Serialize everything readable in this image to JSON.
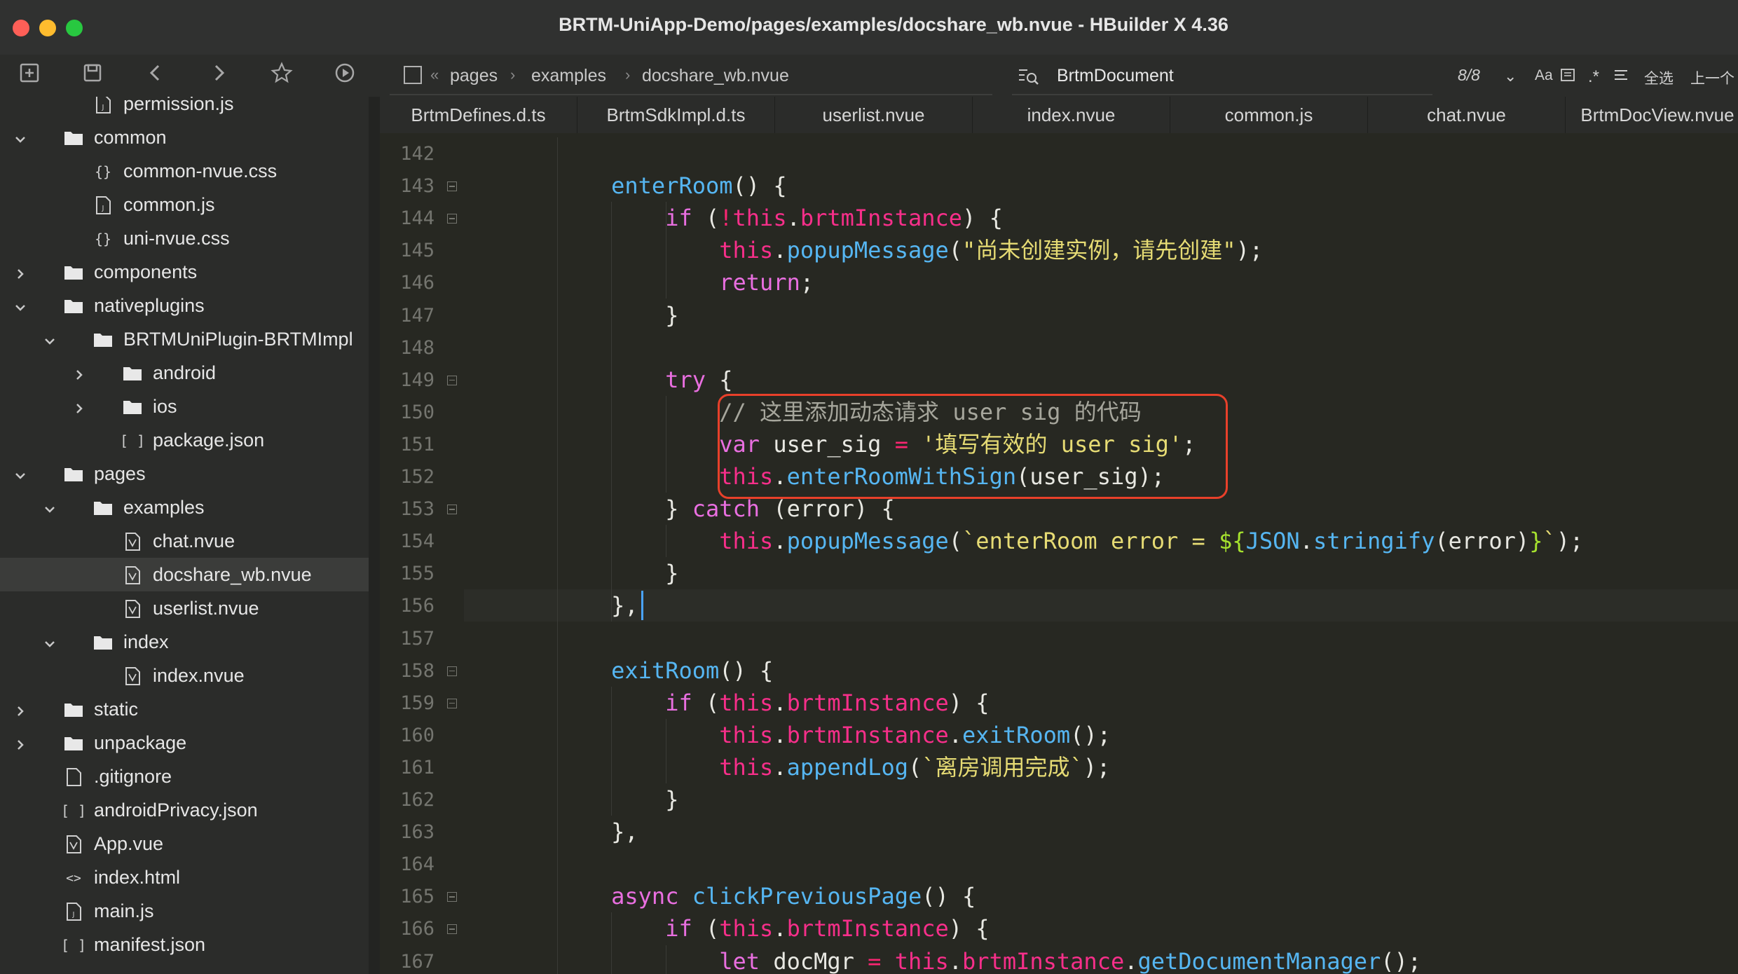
{
  "window": {
    "title": "BRTM-UniApp-Demo/pages/examples/docshare_wb.nvue - HBuilder X 4.36"
  },
  "toolbar": {
    "breadcrumb": [
      "pages",
      "examples",
      "docshare_wb.nvue"
    ],
    "breadcrumb_prefix": "«",
    "search": {
      "value": "BrtmDocument"
    },
    "match_count": "8/8",
    "options": [
      "Aa",
      "全选",
      "上一个"
    ]
  },
  "sidebar": {
    "items": [
      {
        "label": "permission.js",
        "depth": 2,
        "icon": "js-file-icon",
        "chevron": ""
      },
      {
        "label": "common",
        "depth": 1,
        "icon": "folder-icon",
        "chevron": "open"
      },
      {
        "label": "common-nvue.css",
        "depth": 2,
        "icon": "css-file-icon",
        "chevron": ""
      },
      {
        "label": "common.js",
        "depth": 2,
        "icon": "js-file-icon",
        "chevron": ""
      },
      {
        "label": "uni-nvue.css",
        "depth": 2,
        "icon": "css-file-icon",
        "chevron": ""
      },
      {
        "label": "components",
        "depth": 1,
        "icon": "folder-icon",
        "chevron": "closed"
      },
      {
        "label": "nativeplugins",
        "depth": 1,
        "icon": "folder-icon",
        "chevron": "open"
      },
      {
        "label": "BRTMUniPlugin-BRTMImpl",
        "depth": 2,
        "icon": "folder-icon",
        "chevron": "open"
      },
      {
        "label": "android",
        "depth": 3,
        "icon": "folder-icon",
        "chevron": "closed"
      },
      {
        "label": "ios",
        "depth": 3,
        "icon": "folder-icon",
        "chevron": "closed"
      },
      {
        "label": "package.json",
        "depth": 3,
        "icon": "json-file-icon",
        "chevron": ""
      },
      {
        "label": "pages",
        "depth": 1,
        "icon": "folder-icon",
        "chevron": "open"
      },
      {
        "label": "examples",
        "depth": 2,
        "icon": "folder-icon",
        "chevron": "open"
      },
      {
        "label": "chat.nvue",
        "depth": 3,
        "icon": "vue-file-icon",
        "chevron": ""
      },
      {
        "label": "docshare_wb.nvue",
        "depth": 3,
        "icon": "vue-file-icon",
        "chevron": "",
        "selected": true
      },
      {
        "label": "userlist.nvue",
        "depth": 3,
        "icon": "vue-file-icon",
        "chevron": ""
      },
      {
        "label": "index",
        "depth": 2,
        "icon": "folder-icon",
        "chevron": "open"
      },
      {
        "label": "index.nvue",
        "depth": 3,
        "icon": "vue-file-icon",
        "chevron": ""
      },
      {
        "label": "static",
        "depth": 1,
        "icon": "folder-icon",
        "chevron": "closed"
      },
      {
        "label": "unpackage",
        "depth": 1,
        "icon": "folder-icon",
        "chevron": "closed"
      },
      {
        "label": ".gitignore",
        "depth": 1,
        "icon": "file-icon",
        "chevron": ""
      },
      {
        "label": "androidPrivacy.json",
        "depth": 1,
        "icon": "json-file-icon",
        "chevron": ""
      },
      {
        "label": "App.vue",
        "depth": 1,
        "icon": "vue-file-icon",
        "chevron": ""
      },
      {
        "label": "index.html",
        "depth": 1,
        "icon": "html-file-icon",
        "chevron": ""
      },
      {
        "label": "main.js",
        "depth": 1,
        "icon": "js-file-icon",
        "chevron": ""
      },
      {
        "label": "manifest.json",
        "depth": 1,
        "icon": "json-file-icon",
        "chevron": ""
      }
    ]
  },
  "tabs": [
    "BrtmDefines.d.ts",
    "BrtmSdkImpl.d.ts",
    "userlist.nvue",
    "index.nvue",
    "common.js",
    "chat.nvue",
    "BrtmDocView.nvue"
  ],
  "editor": {
    "lines": [
      {
        "n": "142",
        "fold": false,
        "tokens": []
      },
      {
        "n": "143",
        "fold": true,
        "tokens": [
          [
            "pl",
            "        "
          ],
          [
            "fn",
            "enterRoom"
          ],
          [
            "pl",
            "() {"
          ]
        ]
      },
      {
        "n": "144",
        "fold": true,
        "tokens": [
          [
            "pl",
            "            "
          ],
          [
            "ky",
            "if"
          ],
          [
            "pl",
            " ("
          ],
          [
            "k",
            "!"
          ],
          [
            "th",
            "this"
          ],
          [
            "pl",
            "."
          ],
          [
            "th",
            "brtmInstance"
          ],
          [
            "pl",
            ") {"
          ]
        ]
      },
      {
        "n": "145",
        "fold": false,
        "tokens": [
          [
            "pl",
            "                "
          ],
          [
            "th",
            "this"
          ],
          [
            "pl",
            "."
          ],
          [
            "fn",
            "popupMessage"
          ],
          [
            "pl",
            "("
          ],
          [
            "st",
            "\"尚未创建实例，请先创建\""
          ],
          [
            "pl",
            ");"
          ]
        ]
      },
      {
        "n": "146",
        "fold": false,
        "tokens": [
          [
            "pl",
            "                "
          ],
          [
            "ky",
            "return"
          ],
          [
            "pl",
            ";"
          ]
        ]
      },
      {
        "n": "147",
        "fold": false,
        "tokens": [
          [
            "pl",
            "            }"
          ]
        ]
      },
      {
        "n": "148",
        "fold": false,
        "tokens": []
      },
      {
        "n": "149",
        "fold": true,
        "tokens": [
          [
            "pl",
            "            "
          ],
          [
            "ky",
            "try"
          ],
          [
            "pl",
            " {"
          ]
        ]
      },
      {
        "n": "150",
        "fold": false,
        "tokens": [
          [
            "pl",
            "                "
          ],
          [
            "cm",
            "// 这里添加动态请求 user sig 的代码"
          ]
        ]
      },
      {
        "n": "151",
        "fold": false,
        "tokens": [
          [
            "pl",
            "                "
          ],
          [
            "ky",
            "var"
          ],
          [
            "pl",
            " user_sig "
          ],
          [
            "k",
            "="
          ],
          [
            "pl",
            " "
          ],
          [
            "st",
            "'填写有效的 user sig'"
          ],
          [
            "pl",
            ";"
          ]
        ]
      },
      {
        "n": "152",
        "fold": false,
        "tokens": [
          [
            "pl",
            "                "
          ],
          [
            "th",
            "this"
          ],
          [
            "pl",
            "."
          ],
          [
            "fn",
            "enterRoomWithSign"
          ],
          [
            "pl",
            "(user_sig);"
          ]
        ]
      },
      {
        "n": "153",
        "fold": true,
        "tokens": [
          [
            "pl",
            "            } "
          ],
          [
            "ky",
            "catch"
          ],
          [
            "pl",
            " (error) {"
          ]
        ]
      },
      {
        "n": "154",
        "fold": false,
        "tokens": [
          [
            "pl",
            "                "
          ],
          [
            "th",
            "this"
          ],
          [
            "pl",
            "."
          ],
          [
            "fn",
            "popupMessage"
          ],
          [
            "pl",
            "("
          ],
          [
            "st",
            "`enterRoom error = "
          ],
          [
            "grn",
            "${"
          ],
          [
            "fn",
            "JSON"
          ],
          [
            "pl",
            "."
          ],
          [
            "fn",
            "stringify"
          ],
          [
            "pl",
            "(error)"
          ],
          [
            "grn",
            "}"
          ],
          [
            "st",
            "`"
          ],
          [
            "pl",
            ");"
          ]
        ]
      },
      {
        "n": "155",
        "fold": false,
        "tokens": [
          [
            "pl",
            "            }"
          ]
        ]
      },
      {
        "n": "156",
        "fold": false,
        "tokens": [
          [
            "pl",
            "        },"
          ]
        ],
        "current": true
      },
      {
        "n": "157",
        "fold": false,
        "tokens": []
      },
      {
        "n": "158",
        "fold": true,
        "tokens": [
          [
            "pl",
            "        "
          ],
          [
            "fn",
            "exitRoom"
          ],
          [
            "pl",
            "() {"
          ]
        ]
      },
      {
        "n": "159",
        "fold": true,
        "tokens": [
          [
            "pl",
            "            "
          ],
          [
            "ky",
            "if"
          ],
          [
            "pl",
            " ("
          ],
          [
            "th",
            "this"
          ],
          [
            "pl",
            "."
          ],
          [
            "th",
            "brtmInstance"
          ],
          [
            "pl",
            ") {"
          ]
        ]
      },
      {
        "n": "160",
        "fold": false,
        "tokens": [
          [
            "pl",
            "                "
          ],
          [
            "th",
            "this"
          ],
          [
            "pl",
            "."
          ],
          [
            "th",
            "brtmInstance"
          ],
          [
            "pl",
            "."
          ],
          [
            "fn",
            "exitRoom"
          ],
          [
            "pl",
            "();"
          ]
        ]
      },
      {
        "n": "161",
        "fold": false,
        "tokens": [
          [
            "pl",
            "                "
          ],
          [
            "th",
            "this"
          ],
          [
            "pl",
            "."
          ],
          [
            "fn",
            "appendLog"
          ],
          [
            "pl",
            "("
          ],
          [
            "st",
            "`离房调用完成`"
          ],
          [
            "pl",
            ");"
          ]
        ]
      },
      {
        "n": "162",
        "fold": false,
        "tokens": [
          [
            "pl",
            "            }"
          ]
        ]
      },
      {
        "n": "163",
        "fold": false,
        "tokens": [
          [
            "pl",
            "        },"
          ]
        ]
      },
      {
        "n": "164",
        "fold": false,
        "tokens": []
      },
      {
        "n": "165",
        "fold": true,
        "tokens": [
          [
            "pl",
            "        "
          ],
          [
            "ky",
            "async"
          ],
          [
            "pl",
            " "
          ],
          [
            "fn",
            "clickPreviousPage"
          ],
          [
            "pl",
            "() {"
          ]
        ]
      },
      {
        "n": "166",
        "fold": true,
        "tokens": [
          [
            "pl",
            "            "
          ],
          [
            "ky",
            "if"
          ],
          [
            "pl",
            " ("
          ],
          [
            "th",
            "this"
          ],
          [
            "pl",
            "."
          ],
          [
            "th",
            "brtmInstance"
          ],
          [
            "pl",
            ") {"
          ]
        ]
      },
      {
        "n": "167",
        "fold": false,
        "tokens": [
          [
            "pl",
            "                "
          ],
          [
            "ky",
            "let"
          ],
          [
            "pl",
            " docMgr "
          ],
          [
            "k",
            "="
          ],
          [
            "pl",
            " "
          ],
          [
            "th",
            "this"
          ],
          [
            "pl",
            "."
          ],
          [
            "th",
            "brtmInstance"
          ],
          [
            "pl",
            "."
          ],
          [
            "fn",
            "getDocumentManager"
          ],
          [
            "pl",
            "();"
          ]
        ]
      }
    ]
  }
}
